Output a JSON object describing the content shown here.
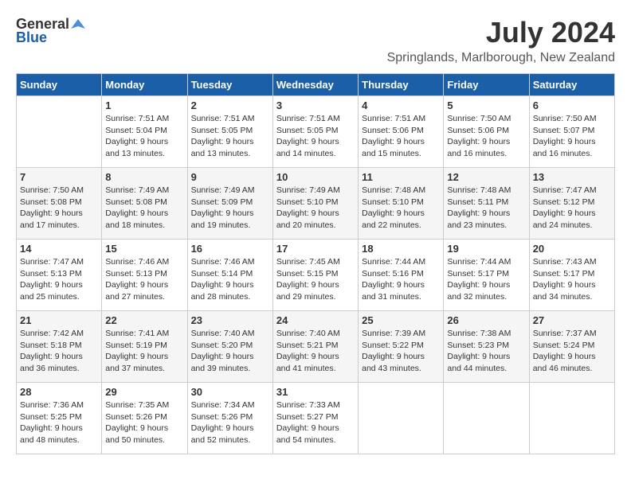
{
  "header": {
    "logo_general": "General",
    "logo_blue": "Blue",
    "month_year": "July 2024",
    "location": "Springlands, Marlborough, New Zealand"
  },
  "calendar": {
    "days_of_week": [
      "Sunday",
      "Monday",
      "Tuesday",
      "Wednesday",
      "Thursday",
      "Friday",
      "Saturday"
    ],
    "weeks": [
      [
        {
          "day": "",
          "sunrise": "",
          "sunset": "",
          "daylight": ""
        },
        {
          "day": "1",
          "sunrise": "Sunrise: 7:51 AM",
          "sunset": "Sunset: 5:04 PM",
          "daylight": "Daylight: 9 hours and 13 minutes."
        },
        {
          "day": "2",
          "sunrise": "Sunrise: 7:51 AM",
          "sunset": "Sunset: 5:05 PM",
          "daylight": "Daylight: 9 hours and 13 minutes."
        },
        {
          "day": "3",
          "sunrise": "Sunrise: 7:51 AM",
          "sunset": "Sunset: 5:05 PM",
          "daylight": "Daylight: 9 hours and 14 minutes."
        },
        {
          "day": "4",
          "sunrise": "Sunrise: 7:51 AM",
          "sunset": "Sunset: 5:06 PM",
          "daylight": "Daylight: 9 hours and 15 minutes."
        },
        {
          "day": "5",
          "sunrise": "Sunrise: 7:50 AM",
          "sunset": "Sunset: 5:06 PM",
          "daylight": "Daylight: 9 hours and 16 minutes."
        },
        {
          "day": "6",
          "sunrise": "Sunrise: 7:50 AM",
          "sunset": "Sunset: 5:07 PM",
          "daylight": "Daylight: 9 hours and 16 minutes."
        }
      ],
      [
        {
          "day": "7",
          "sunrise": "Sunrise: 7:50 AM",
          "sunset": "Sunset: 5:08 PM",
          "daylight": "Daylight: 9 hours and 17 minutes."
        },
        {
          "day": "8",
          "sunrise": "Sunrise: 7:49 AM",
          "sunset": "Sunset: 5:08 PM",
          "daylight": "Daylight: 9 hours and 18 minutes."
        },
        {
          "day": "9",
          "sunrise": "Sunrise: 7:49 AM",
          "sunset": "Sunset: 5:09 PM",
          "daylight": "Daylight: 9 hours and 19 minutes."
        },
        {
          "day": "10",
          "sunrise": "Sunrise: 7:49 AM",
          "sunset": "Sunset: 5:10 PM",
          "daylight": "Daylight: 9 hours and 20 minutes."
        },
        {
          "day": "11",
          "sunrise": "Sunrise: 7:48 AM",
          "sunset": "Sunset: 5:10 PM",
          "daylight": "Daylight: 9 hours and 22 minutes."
        },
        {
          "day": "12",
          "sunrise": "Sunrise: 7:48 AM",
          "sunset": "Sunset: 5:11 PM",
          "daylight": "Daylight: 9 hours and 23 minutes."
        },
        {
          "day": "13",
          "sunrise": "Sunrise: 7:47 AM",
          "sunset": "Sunset: 5:12 PM",
          "daylight": "Daylight: 9 hours and 24 minutes."
        }
      ],
      [
        {
          "day": "14",
          "sunrise": "Sunrise: 7:47 AM",
          "sunset": "Sunset: 5:13 PM",
          "daylight": "Daylight: 9 hours and 25 minutes."
        },
        {
          "day": "15",
          "sunrise": "Sunrise: 7:46 AM",
          "sunset": "Sunset: 5:13 PM",
          "daylight": "Daylight: 9 hours and 27 minutes."
        },
        {
          "day": "16",
          "sunrise": "Sunrise: 7:46 AM",
          "sunset": "Sunset: 5:14 PM",
          "daylight": "Daylight: 9 hours and 28 minutes."
        },
        {
          "day": "17",
          "sunrise": "Sunrise: 7:45 AM",
          "sunset": "Sunset: 5:15 PM",
          "daylight": "Daylight: 9 hours and 29 minutes."
        },
        {
          "day": "18",
          "sunrise": "Sunrise: 7:44 AM",
          "sunset": "Sunset: 5:16 PM",
          "daylight": "Daylight: 9 hours and 31 minutes."
        },
        {
          "day": "19",
          "sunrise": "Sunrise: 7:44 AM",
          "sunset": "Sunset: 5:17 PM",
          "daylight": "Daylight: 9 hours and 32 minutes."
        },
        {
          "day": "20",
          "sunrise": "Sunrise: 7:43 AM",
          "sunset": "Sunset: 5:17 PM",
          "daylight": "Daylight: 9 hours and 34 minutes."
        }
      ],
      [
        {
          "day": "21",
          "sunrise": "Sunrise: 7:42 AM",
          "sunset": "Sunset: 5:18 PM",
          "daylight": "Daylight: 9 hours and 36 minutes."
        },
        {
          "day": "22",
          "sunrise": "Sunrise: 7:41 AM",
          "sunset": "Sunset: 5:19 PM",
          "daylight": "Daylight: 9 hours and 37 minutes."
        },
        {
          "day": "23",
          "sunrise": "Sunrise: 7:40 AM",
          "sunset": "Sunset: 5:20 PM",
          "daylight": "Daylight: 9 hours and 39 minutes."
        },
        {
          "day": "24",
          "sunrise": "Sunrise: 7:40 AM",
          "sunset": "Sunset: 5:21 PM",
          "daylight": "Daylight: 9 hours and 41 minutes."
        },
        {
          "day": "25",
          "sunrise": "Sunrise: 7:39 AM",
          "sunset": "Sunset: 5:22 PM",
          "daylight": "Daylight: 9 hours and 43 minutes."
        },
        {
          "day": "26",
          "sunrise": "Sunrise: 7:38 AM",
          "sunset": "Sunset: 5:23 PM",
          "daylight": "Daylight: 9 hours and 44 minutes."
        },
        {
          "day": "27",
          "sunrise": "Sunrise: 7:37 AM",
          "sunset": "Sunset: 5:24 PM",
          "daylight": "Daylight: 9 hours and 46 minutes."
        }
      ],
      [
        {
          "day": "28",
          "sunrise": "Sunrise: 7:36 AM",
          "sunset": "Sunset: 5:25 PM",
          "daylight": "Daylight: 9 hours and 48 minutes."
        },
        {
          "day": "29",
          "sunrise": "Sunrise: 7:35 AM",
          "sunset": "Sunset: 5:26 PM",
          "daylight": "Daylight: 9 hours and 50 minutes."
        },
        {
          "day": "30",
          "sunrise": "Sunrise: 7:34 AM",
          "sunset": "Sunset: 5:26 PM",
          "daylight": "Daylight: 9 hours and 52 minutes."
        },
        {
          "day": "31",
          "sunrise": "Sunrise: 7:33 AM",
          "sunset": "Sunset: 5:27 PM",
          "daylight": "Daylight: 9 hours and 54 minutes."
        },
        {
          "day": "",
          "sunrise": "",
          "sunset": "",
          "daylight": ""
        },
        {
          "day": "",
          "sunrise": "",
          "sunset": "",
          "daylight": ""
        },
        {
          "day": "",
          "sunrise": "",
          "sunset": "",
          "daylight": ""
        }
      ]
    ]
  }
}
